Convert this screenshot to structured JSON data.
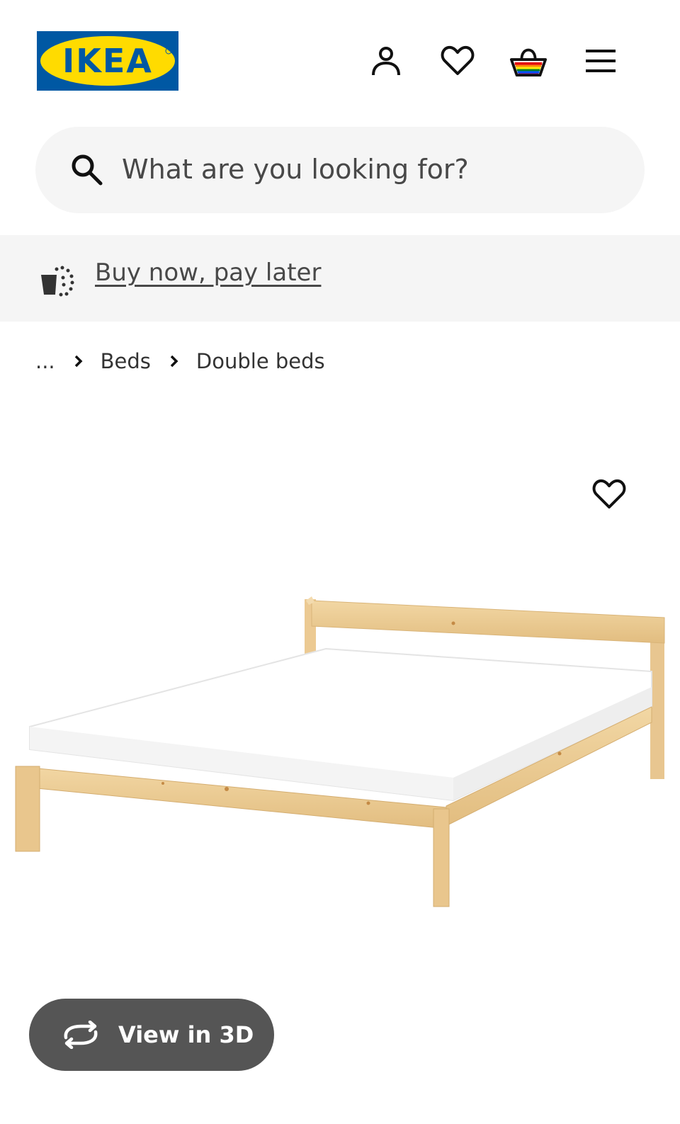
{
  "header": {
    "logo_text": "IKEA",
    "icons": [
      "user-icon",
      "heart-icon",
      "basket-icon",
      "menu-icon"
    ]
  },
  "search": {
    "placeholder": "What are you looking for?"
  },
  "banner": {
    "link_text": "Buy now, pay later"
  },
  "breadcrumb": {
    "ellipsis": "...",
    "items": [
      "Beds",
      "Double beds"
    ]
  },
  "product": {
    "view3d_label": "View in 3D"
  },
  "colors": {
    "ikea_blue": "#0058a3",
    "ikea_yellow": "#ffdb00",
    "search_bg": "#f5f5f5",
    "button_bg": "#555555"
  }
}
